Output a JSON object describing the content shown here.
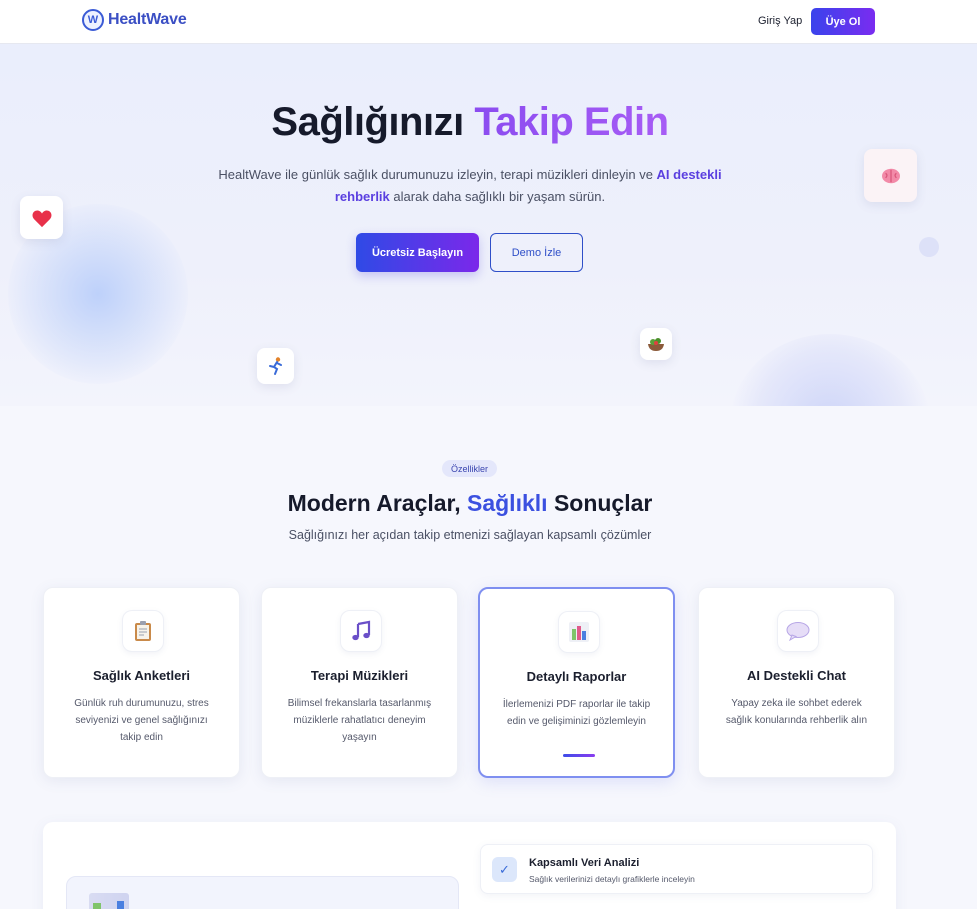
{
  "nav": {
    "brand_name": "HealtWave",
    "brand_logo": "W",
    "login_label": "Giriş Yap",
    "signup_label": "Üye Ol"
  },
  "hero": {
    "title_main": "Sağlığınızı",
    "title_accent": "Takip Edin",
    "subtitle_part1": "HealtWave ile günlük sağlık durumunuzu izleyin, terapi müzikleri dinleyin ve",
    "subtitle_highlight": "AI destekli rehberlik",
    "subtitle_part2": "alarak daha sağlıklı bir yaşam sürün.",
    "cta_primary": "Ücretsiz Başlayın",
    "cta_secondary": "Demo İzle",
    "floating_icons": [
      "heart-icon",
      "brain-icon",
      "runner-icon",
      "salad-icon"
    ]
  },
  "features": {
    "pill": "Özellikler",
    "title_part1": "Modern Araçlar,",
    "title_accent": "Sağlıklı",
    "title_part2": "Sonuçlar",
    "subtitle": "Sağlığınızı her açıdan takip etmenizi sağlayan kapsamlı çözümler",
    "cards": [
      {
        "icon": "clipboard-icon",
        "title": "Sağlık Anketleri",
        "desc": "Günlük ruh durumunuzu, stres seviyenizi ve genel sağlığınızı takip edin"
      },
      {
        "icon": "music-icon",
        "title": "Terapi Müzikleri",
        "desc": "Bilimsel frekanslarla tasarlanmış müziklerle rahatlatıcı deneyim yaşayın"
      },
      {
        "icon": "chart-icon",
        "title": "Detaylı Raporlar",
        "desc": "İlerlemenizi PDF raporlar ile takip edin ve gelişiminizi gözlemleyin"
      },
      {
        "icon": "chat-icon",
        "title": "AI Destekli Chat",
        "desc": "Yapay zeka ile sohbet ederek sağlık konularında rehberlik alın"
      }
    ]
  },
  "analysis": {
    "title": "Kapsamlı Veri Analizi",
    "desc": "Sağlık verilerinizi detaylı grafiklerle inceleyin",
    "check": "✓"
  },
  "colors": {
    "brand": "#3b4fc4",
    "accent_purple": "#8b4cf0",
    "accent_blue": "#3b50e0"
  }
}
